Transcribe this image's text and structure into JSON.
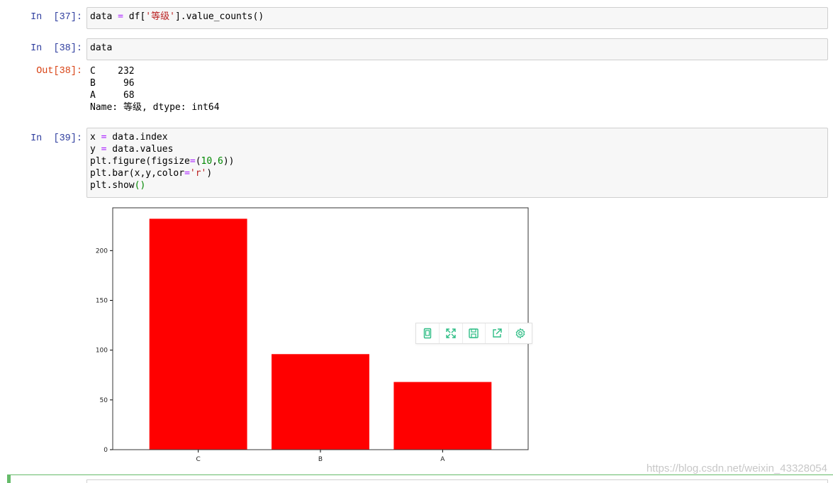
{
  "cells": [
    {
      "prompt": "In  [37]:",
      "lines": [
        [
          {
            "t": "data "
          },
          {
            "t": "=",
            "c": "op"
          },
          {
            "t": " df["
          },
          {
            "t": "'等级'",
            "c": "str"
          },
          {
            "t": "].value_counts()"
          }
        ]
      ]
    },
    {
      "prompt": "In  [38]:",
      "lines": [
        [
          {
            "t": "data"
          }
        ]
      ]
    },
    {
      "prompt": "In  [39]:",
      "lines": [
        [
          {
            "t": "x "
          },
          {
            "t": "=",
            "c": "op"
          },
          {
            "t": " data.index"
          }
        ],
        [
          {
            "t": "y "
          },
          {
            "t": "=",
            "c": "op"
          },
          {
            "t": " data.values"
          }
        ],
        [
          {
            "t": "plt.figure(figsize"
          },
          {
            "t": "=",
            "c": "op"
          },
          {
            "t": "("
          },
          {
            "t": "10",
            "c": "num"
          },
          {
            "t": ","
          },
          {
            "t": "6",
            "c": "num"
          },
          {
            "t": "))"
          }
        ],
        [
          {
            "t": "plt.bar(x,y,color"
          },
          {
            "t": "=",
            "c": "op"
          },
          {
            "t": "'r'",
            "c": "str"
          },
          {
            "t": ")"
          }
        ],
        [
          {
            "t": "plt.show"
          },
          {
            "t": "()",
            "c": "num"
          }
        ]
      ]
    }
  ],
  "output": {
    "prompt": "Out[38]:",
    "lines": [
      "C    232",
      "B     96",
      "A     68",
      "Name: 等级, dtype: int64"
    ]
  },
  "chart_data": {
    "type": "bar",
    "categories": [
      "C",
      "B",
      "A"
    ],
    "values": [
      232,
      96,
      68
    ],
    "color": "#ff0000",
    "ylim": [
      0,
      243
    ],
    "yticks": [
      0,
      50,
      100,
      150,
      200
    ],
    "title": "",
    "xlabel": "",
    "ylabel": "",
    "grid": false
  },
  "toolbar": {
    "icons": [
      "copy-icon",
      "expand-icon",
      "save-icon",
      "share-icon",
      "settings-icon"
    ],
    "color": "#2ebd85"
  },
  "watermark": "https://blog.csdn.net/weixin_43328054"
}
